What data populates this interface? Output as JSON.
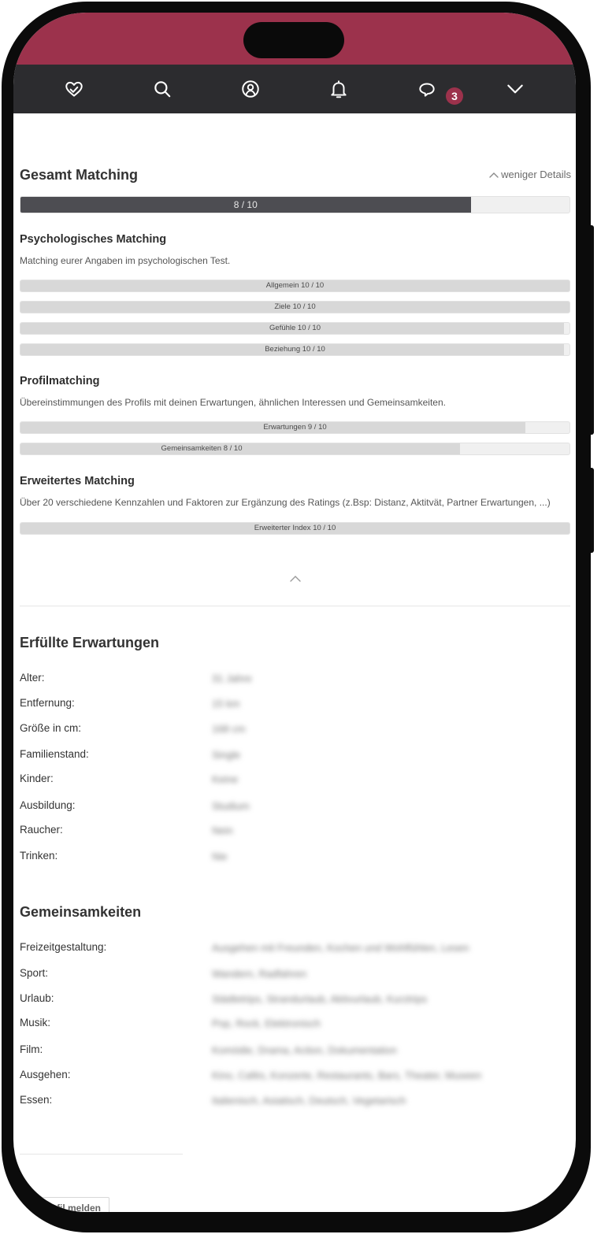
{
  "nav": {
    "icons": [
      "heart-icon",
      "search-icon",
      "profile-icon",
      "bell-icon",
      "chat-icon",
      "chevron-down-icon"
    ],
    "chat_badge": "3"
  },
  "colors": {
    "accent": "#9c324c",
    "nav_bg": "#2c2c2f",
    "main_bar": "#4d4d52"
  },
  "overall": {
    "title": "Gesamt Matching",
    "toggle_label": "weniger Details",
    "score_label": "8 / 10",
    "score_fraction": 0.82
  },
  "psych": {
    "title": "Psychologisches Matching",
    "desc": "Matching eurer Angaben im psychologischen Test.",
    "bars": [
      {
        "label": "Allgemein  10 / 10",
        "fraction": 1.0
      },
      {
        "label": "Ziele  10 / 10",
        "fraction": 1.0
      },
      {
        "label": "Gefühle  10 / 10",
        "fraction": 0.99
      },
      {
        "label": "Beziehung  10 / 10",
        "fraction": 0.99
      }
    ]
  },
  "profile": {
    "title": "Profilmatching",
    "desc": "Übereinstimmungen des Profils mit deinen Erwartungen, ähnlichen Interessen und Gemeinsamkeiten.",
    "bars": [
      {
        "label": "Erwartungen  9 / 10",
        "fraction": 0.92
      },
      {
        "label": "Gemeinsamkeiten  8 / 10",
        "fraction": 0.8
      }
    ]
  },
  "extended": {
    "title": "Erweitertes Matching",
    "desc": "Über 20 verschiedene Kennzahlen und Faktoren zur Ergänzung des Ratings (z.Bsp: Distanz, Aktitvät, Partner Erwartungen, ...)",
    "bars": [
      {
        "label": "Erweiterter Index  10 / 10",
        "fraction": 1.0
      }
    ]
  },
  "expectations": {
    "title": "Erfüllte Erwartungen",
    "rows": [
      {
        "label": "Alter:",
        "value": "31 Jahre"
      },
      {
        "label": "Entfernung:",
        "value": "15 km"
      },
      {
        "label": "Größe in cm:",
        "value": "168 cm"
      },
      {
        "label": "Familienstand:",
        "value": "Single"
      },
      {
        "label": "Kinder:",
        "value": "Keine"
      },
      {
        "label": "Ausbildung:",
        "value": "Studium"
      },
      {
        "label": "Raucher:",
        "value": "Nein"
      },
      {
        "label": "Trinken:",
        "value": "Nie"
      }
    ]
  },
  "commons": {
    "title": "Gemeinsamkeiten",
    "rows": [
      {
        "label": "Freizeitgestaltung:",
        "value": "Ausgehen mit Freunden, Kochen und Wohlfühlen, Lesen"
      },
      {
        "label": "Sport:",
        "value": "Wandern, Radfahren"
      },
      {
        "label": "Urlaub:",
        "value": "Städtetrips, Strandurlaub, Aktivurlaub, Kurztrips"
      },
      {
        "label": "Musik:",
        "value": "Pop, Rock, Elektronisch"
      },
      {
        "label": "Film:",
        "value": "Komödie, Drama, Action, Dokumentation"
      },
      {
        "label": "Ausgehen:",
        "value": "Kino, Cafés, Konzerte, Restaurants, Bars, Theater, Museen"
      },
      {
        "label": "Essen:",
        "value": "Italienisch, Asiatisch, Deutsch, Vegetarisch"
      }
    ]
  },
  "report_button": "Profil melden"
}
